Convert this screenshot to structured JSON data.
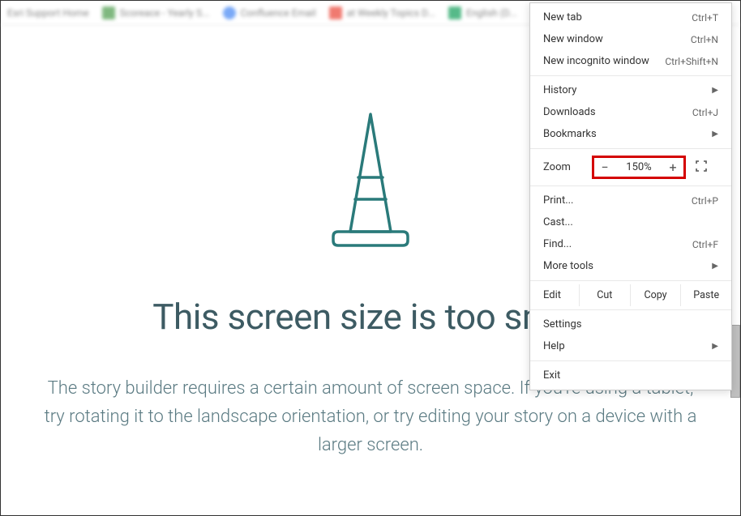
{
  "bookmarks": [
    {
      "label": "Esri Support Home"
    },
    {
      "label": "Scoreace - Yearly S..."
    },
    {
      "label": "Confluence Email"
    },
    {
      "label": "at Weekly Topics D..."
    },
    {
      "label": "English (D..."
    }
  ],
  "menu": {
    "new_tab": {
      "label": "New tab",
      "shortcut": "Ctrl+T"
    },
    "new_window": {
      "label": "New window",
      "shortcut": "Ctrl+N"
    },
    "new_incognito": {
      "label": "New incognito window",
      "shortcut": "Ctrl+Shift+N"
    },
    "history": {
      "label": "History"
    },
    "downloads": {
      "label": "Downloads",
      "shortcut": "Ctrl+J"
    },
    "bookmarks": {
      "label": "Bookmarks"
    },
    "zoom": {
      "label": "Zoom",
      "value": "150%",
      "minus": "−",
      "plus": "+"
    },
    "print": {
      "label": "Print...",
      "shortcut": "Ctrl+P"
    },
    "cast": {
      "label": "Cast..."
    },
    "find": {
      "label": "Find...",
      "shortcut": "Ctrl+F"
    },
    "more_tools": {
      "label": "More tools"
    },
    "edit": {
      "label": "Edit",
      "cut": "Cut",
      "copy": "Copy",
      "paste": "Paste"
    },
    "settings": {
      "label": "Settings"
    },
    "help": {
      "label": "Help"
    },
    "exit": {
      "label": "Exit"
    }
  },
  "page": {
    "heading": "This screen size is too small",
    "description": "The story builder requires a certain amount of screen space. If you're using a tablet, try rotating it to the landscape orientation, or try editing your story on a device with a larger screen."
  }
}
